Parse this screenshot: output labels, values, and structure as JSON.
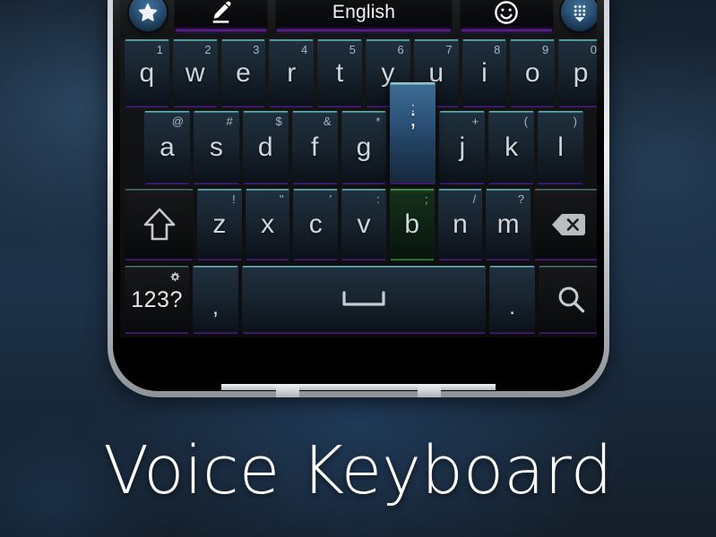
{
  "app": {
    "title": "Voice Keyboard"
  },
  "toolbar": {
    "favorite_icon": "star-icon",
    "compose_icon": "pencil-icon",
    "language_label": "English",
    "emoji_icon": "smiley-icon",
    "hide_keyboard_icon": "keypad-down-icon"
  },
  "keyboard": {
    "row1": [
      {
        "glyph": "q",
        "hint": "1"
      },
      {
        "glyph": "w",
        "hint": "2"
      },
      {
        "glyph": "e",
        "hint": "3"
      },
      {
        "glyph": "r",
        "hint": "4"
      },
      {
        "glyph": "t",
        "hint": "5"
      },
      {
        "glyph": "y",
        "hint": "6"
      },
      {
        "glyph": "u",
        "hint": "7"
      },
      {
        "glyph": "i",
        "hint": "8"
      },
      {
        "glyph": "o",
        "hint": "9"
      },
      {
        "glyph": "p",
        "hint": "0"
      }
    ],
    "row2": [
      {
        "glyph": "a",
        "hint": "@"
      },
      {
        "glyph": "s",
        "hint": "#"
      },
      {
        "glyph": "d",
        "hint": "$"
      },
      {
        "glyph": "f",
        "hint": "&"
      },
      {
        "glyph": "g",
        "hint": "*"
      },
      {
        "glyph": ";",
        "hint": ":",
        "state": "pressed"
      },
      {
        "glyph": "j",
        "hint": "+"
      },
      {
        "glyph": "k",
        "hint": "("
      },
      {
        "glyph": "l",
        "hint": ")"
      }
    ],
    "row3": [
      {
        "glyph": "z",
        "hint": "!"
      },
      {
        "glyph": "x",
        "hint": "\""
      },
      {
        "glyph": "c",
        "hint": "'"
      },
      {
        "glyph": "v",
        "hint": ":"
      },
      {
        "glyph": "b",
        "hint": ";",
        "state": "highlighted"
      },
      {
        "glyph": "n",
        "hint": "/"
      },
      {
        "glyph": "m",
        "hint": "?"
      }
    ],
    "shift_icon": "shift-arrow-icon",
    "backspace_icon": "backspace-icon",
    "row4": {
      "symbols_label": "123?",
      "settings_icon": "gear-icon",
      "comma": ",",
      "space_icon": "space-bar-icon",
      "period": ".",
      "search_icon": "search-icon"
    }
  },
  "colors": {
    "accent_teal": "#5ad2d7",
    "accent_purple": "#6a25a8",
    "accent_green": "#27a634",
    "key_face": "#18242f",
    "toolbar_bg": "#191a1c",
    "background": "#1d3249"
  }
}
